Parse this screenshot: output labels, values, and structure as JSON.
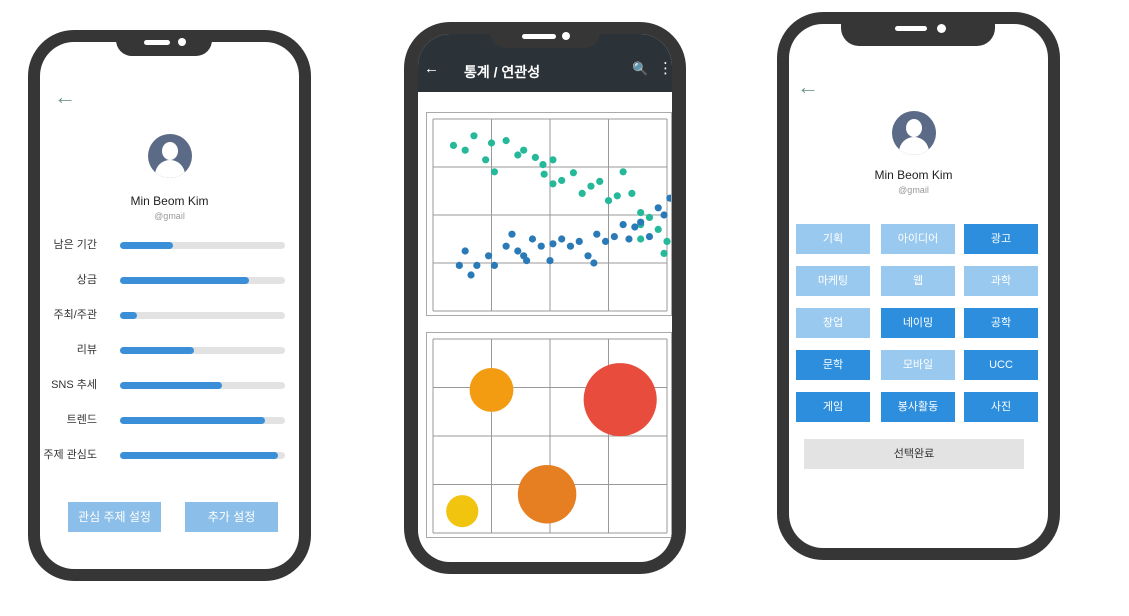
{
  "phone1": {
    "back_icon": "←",
    "user": {
      "name": "Min Beom Kim",
      "email": "@gmail"
    },
    "metrics": [
      {
        "label": "남은 기간",
        "progress": 0.32
      },
      {
        "label": "상금",
        "progress": 0.78
      },
      {
        "label": "주최/주관",
        "progress": 0.1
      },
      {
        "label": "리뷰",
        "progress": 0.45
      },
      {
        "label": "SNS 추세",
        "progress": 0.62
      },
      {
        "label": "트렌드",
        "progress": 0.88
      },
      {
        "label": "주제 관심도",
        "progress": 0.96
      }
    ],
    "buttons": {
      "interest": "관심 주제 설정",
      "extra": "추가 설정"
    }
  },
  "phone2": {
    "title": "통계 / 연관성",
    "back_icon": "←",
    "search_icon": "🔍",
    "menu_icon": "⋮",
    "colors": {
      "teal": "#25b99a",
      "blue": "#2a7ab8",
      "orange": "#f39c12",
      "red": "#e74c3c",
      "dark_orange": "#e67e22",
      "yellow": "#f1c40f"
    },
    "chart_data": [
      {
        "type": "scatter",
        "xlim": [
          0,
          4
        ],
        "ylim": [
          0,
          4
        ],
        "grid": true,
        "series": [
          {
            "color": "#25b99a",
            "points": [
              [
                0.35,
                3.45
              ],
              [
                0.55,
                3.35
              ],
              [
                0.7,
                3.65
              ],
              [
                0.9,
                3.15
              ],
              [
                1.0,
                3.5
              ],
              [
                1.25,
                3.55
              ],
              [
                1.45,
                3.25
              ],
              [
                1.55,
                3.35
              ],
              [
                1.75,
                3.2
              ],
              [
                1.88,
                3.05
              ],
              [
                2.05,
                3.15
              ],
              [
                1.05,
                2.9
              ],
              [
                1.9,
                2.85
              ],
              [
                2.05,
                2.65
              ],
              [
                2.2,
                2.72
              ],
              [
                2.4,
                2.88
              ],
              [
                2.55,
                2.45
              ],
              [
                2.7,
                2.6
              ],
              [
                2.85,
                2.7
              ],
              [
                3.0,
                2.3
              ],
              [
                3.15,
                2.4
              ],
              [
                3.25,
                2.9
              ],
              [
                3.4,
                2.45
              ],
              [
                3.55,
                2.05
              ],
              [
                3.7,
                1.95
              ],
              [
                3.55,
                1.8
              ],
              [
                3.85,
                1.7
              ],
              [
                4.0,
                1.45
              ],
              [
                3.95,
                1.2
              ],
              [
                3.55,
                1.5
              ]
            ]
          },
          {
            "color": "#2a7ab8",
            "points": [
              [
                0.45,
                0.95
              ],
              [
                0.55,
                1.25
              ],
              [
                0.65,
                0.75
              ],
              [
                0.75,
                0.95
              ],
              [
                0.95,
                1.15
              ],
              [
                1.05,
                0.95
              ],
              [
                1.25,
                1.35
              ],
              [
                1.35,
                1.6
              ],
              [
                1.45,
                1.25
              ],
              [
                1.55,
                1.15
              ],
              [
                1.6,
                1.05
              ],
              [
                1.7,
                1.5
              ],
              [
                1.85,
                1.35
              ],
              [
                2.0,
                1.05
              ],
              [
                2.05,
                1.4
              ],
              [
                2.2,
                1.5
              ],
              [
                2.35,
                1.35
              ],
              [
                2.5,
                1.45
              ],
              [
                2.65,
                1.15
              ],
              [
                2.75,
                1.0
              ],
              [
                2.8,
                1.6
              ],
              [
                2.95,
                1.45
              ],
              [
                3.1,
                1.55
              ],
              [
                3.25,
                1.8
              ],
              [
                3.35,
                1.5
              ],
              [
                3.45,
                1.75
              ],
              [
                3.55,
                1.85
              ],
              [
                3.7,
                1.55
              ],
              [
                3.85,
                2.15
              ],
              [
                3.95,
                2.0
              ],
              [
                4.05,
                2.35
              ]
            ]
          }
        ]
      },
      {
        "type": "scatter",
        "xlim": [
          0,
          4
        ],
        "ylim": [
          0,
          4
        ],
        "grid": true,
        "series": [
          {
            "color": "#f39c12",
            "points": [
              [
                1.0,
                2.95
              ]
            ],
            "size": 0.75
          },
          {
            "color": "#e74c3c",
            "points": [
              [
                3.2,
                2.75
              ]
            ],
            "size": 1.25
          },
          {
            "color": "#e67e22",
            "points": [
              [
                1.95,
                0.8
              ]
            ],
            "size": 1.0
          },
          {
            "color": "#f1c40f",
            "points": [
              [
                0.5,
                0.45
              ]
            ],
            "size": 0.55
          }
        ]
      }
    ]
  },
  "phone3": {
    "back_icon": "←",
    "user": {
      "name": "Min Beom Kim",
      "email": "@gmail"
    },
    "tags": [
      {
        "label": "기획",
        "selected": false
      },
      {
        "label": "아이디어",
        "selected": false
      },
      {
        "label": "광고",
        "selected": true
      },
      {
        "label": "마케팅",
        "selected": false
      },
      {
        "label": "웹",
        "selected": false
      },
      {
        "label": "과학",
        "selected": false
      },
      {
        "label": "창업",
        "selected": false
      },
      {
        "label": "네이밍",
        "selected": true
      },
      {
        "label": "공학",
        "selected": true
      },
      {
        "label": "문학",
        "selected": true
      },
      {
        "label": "모바일",
        "selected": false
      },
      {
        "label": "UCC",
        "selected": true
      },
      {
        "label": "게임",
        "selected": true
      },
      {
        "label": "봉사활동",
        "selected": true
      },
      {
        "label": "사진",
        "selected": true
      }
    ],
    "done_button": "선택완료"
  }
}
